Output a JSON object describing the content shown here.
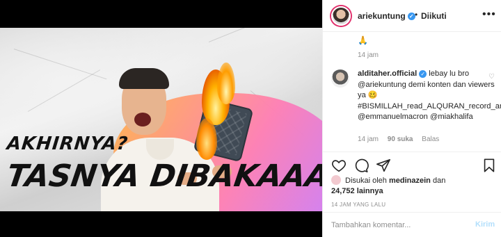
{
  "media": {
    "headline_line1": "AKHIRNYA?",
    "headline_line2": "TASNYA DIBAKAAAAR?"
  },
  "header": {
    "username": "ariekuntung",
    "separator": "•",
    "follow_status": "Diikuti",
    "more_icon": "more-horizontal-icon"
  },
  "comments": {
    "first": {
      "emoji": "🙏",
      "time": "14 jam"
    },
    "second": {
      "username": "alditaher.official",
      "text": "lebay lu bro @ariekuntung demi konten dan viewers ya 🥴 #BISMILLAH_read_ALQURAN_record_and_posting_BARAKALLAH♥ @emmanuelmacron @miakhalifa",
      "time": "14 jam",
      "likes": "90 suka",
      "reply": "Balas"
    }
  },
  "actions": {
    "like": "heart-icon",
    "comment": "comment-icon",
    "share": "share-icon",
    "save": "bookmark-icon"
  },
  "likes": {
    "prefix": "Disukai oleh",
    "user": "medinazein",
    "conjunction": "dan",
    "others": "24,752 lainnya"
  },
  "post_time": "14 JAM YANG LALU",
  "add_comment": {
    "placeholder": "Tambahkan komentar...",
    "post_label": "Kirim"
  },
  "colors": {
    "verified": "#3897f0",
    "story_ring": "#e1306c",
    "post_disabled": "#b2dffc",
    "muted_text": "#8e8e8e"
  }
}
